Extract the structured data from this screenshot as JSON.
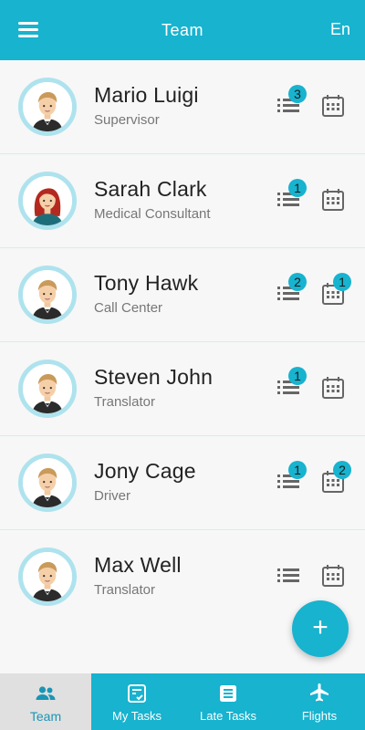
{
  "header": {
    "title": "Team",
    "lang": "En"
  },
  "colors": {
    "accent": "#17b3cf",
    "active_nav_bg": "#e0e0e0"
  },
  "members": [
    {
      "name": "Mario Luigi",
      "role": "Supervisor",
      "tasks_badge": "3",
      "calendar_badge": ""
    },
    {
      "name": "Sarah Clark",
      "role": "Medical Consultant",
      "tasks_badge": "1",
      "calendar_badge": ""
    },
    {
      "name": "Tony Hawk",
      "role": "Call Center",
      "tasks_badge": "2",
      "calendar_badge": "1"
    },
    {
      "name": "Steven John",
      "role": "Translator",
      "tasks_badge": "1",
      "calendar_badge": ""
    },
    {
      "name": "Jony Cage",
      "role": "Driver",
      "tasks_badge": "1",
      "calendar_badge": "2"
    },
    {
      "name": "Max Well",
      "role": "Translator",
      "tasks_badge": "",
      "calendar_badge": ""
    }
  ],
  "fab": {
    "label": "+"
  },
  "nav": [
    {
      "label": "Team",
      "icon": "people-icon",
      "active": true
    },
    {
      "label": "My Tasks",
      "icon": "task-check-icon",
      "active": false
    },
    {
      "label": "Late Tasks",
      "icon": "task-list-icon",
      "active": false
    },
    {
      "label": "Flights",
      "icon": "airplane-icon",
      "active": false
    }
  ]
}
